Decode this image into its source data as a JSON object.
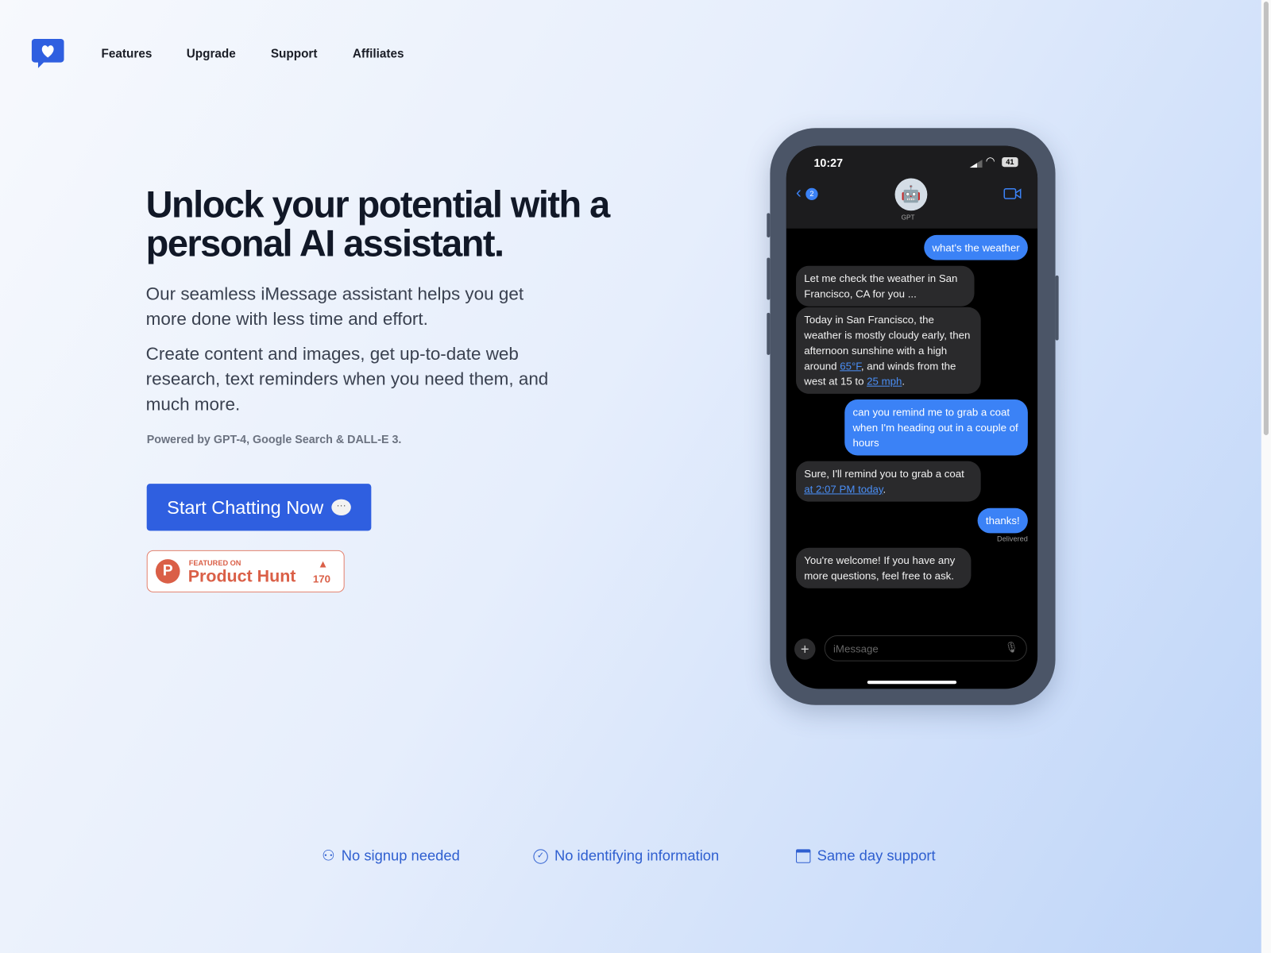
{
  "nav": {
    "items": [
      "Features",
      "Upgrade",
      "Support",
      "Affiliates"
    ]
  },
  "hero": {
    "title": "Unlock your potential with a personal AI assistant.",
    "para1": "Our seamless iMessage assistant helps you get more done with less time and effort.",
    "para2": "Create content and images, get up-to-date web research, text reminders when you need them, and much more.",
    "powered": "Powered by GPT-4, Google Search & DALL-E 3.",
    "cta": "Start Chatting Now",
    "product_hunt": {
      "featured": "FEATURED ON",
      "name": "Product Hunt",
      "votes": "170"
    }
  },
  "phone": {
    "time": "10:27",
    "battery": "41",
    "back_count": "2",
    "contact": "GPT",
    "input_placeholder": "iMessage",
    "delivered": "Delivered",
    "messages": [
      {
        "from": "me",
        "text": "what's the weather"
      },
      {
        "from": "bot",
        "text": "Let me check the weather in San Francisco, CA for you ..."
      },
      {
        "from": "bot",
        "pre": "Today in San Francisco, the weather is mostly cloudy early, then afternoon sunshine with a high around ",
        "link1": "65°F",
        "mid": ", and winds from the west at 15 to ",
        "link2": "25 mph",
        "post": "."
      },
      {
        "from": "me",
        "text": "can you remind me to grab a coat when I'm heading out in a couple of hours"
      },
      {
        "from": "bot",
        "pre": "Sure, I'll remind you to grab a coat ",
        "link1": "at 2:07 PM today",
        "post": "."
      },
      {
        "from": "me",
        "text": "thanks!"
      },
      {
        "from": "bot",
        "text": "You're welcome! If you have any more questions, feel free to ask."
      }
    ]
  },
  "features": [
    {
      "icon": "user-plus-icon",
      "label": "No signup needed"
    },
    {
      "icon": "badge-check-icon",
      "label": "No identifying information"
    },
    {
      "icon": "calendar-icon",
      "label": "Same day support"
    }
  ],
  "colors": {
    "accent": "#2f5fe0",
    "bubble_out": "#3b82f6",
    "product_hunt": "#da5f47"
  }
}
